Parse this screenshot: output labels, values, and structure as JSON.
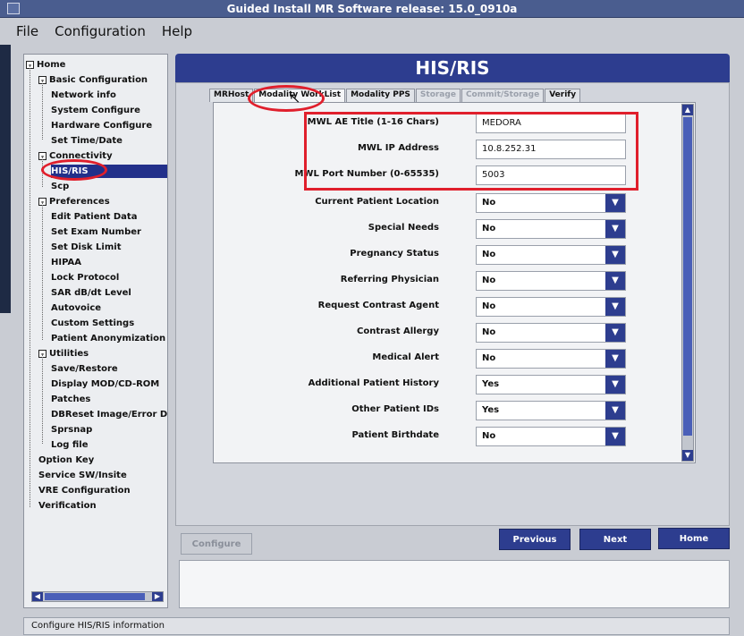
{
  "window": {
    "title": "Guided Install  MR Software release: 15.0_0910a"
  },
  "menu": [
    "File",
    "Configuration",
    "Help"
  ],
  "sidebar": {
    "items": [
      {
        "label": "Home",
        "box": "-"
      },
      {
        "label": "Basic Configuration",
        "box": "-"
      },
      {
        "label": "Network info"
      },
      {
        "label": "System Configure"
      },
      {
        "label": "Hardware Configure"
      },
      {
        "label": "Set Time/Date"
      },
      {
        "label": "Connectivity",
        "box": "-"
      },
      {
        "label": "HIS/RIS",
        "selected": true
      },
      {
        "label": "Scp"
      },
      {
        "label": "Preferences",
        "box": "-"
      },
      {
        "label": "Edit Patient Data"
      },
      {
        "label": "Set Exam Number"
      },
      {
        "label": "Set Disk Limit"
      },
      {
        "label": "HIPAA"
      },
      {
        "label": "Lock Protocol"
      },
      {
        "label": "SAR dB/dt Level"
      },
      {
        "label": "Autovoice"
      },
      {
        "label": "Custom Settings"
      },
      {
        "label": "Patient Anonymization S"
      },
      {
        "label": "Utilities",
        "box": "-"
      },
      {
        "label": "Save/Restore"
      },
      {
        "label": "Display MOD/CD-ROM"
      },
      {
        "label": "Patches"
      },
      {
        "label": "DBReset Image/Error DE"
      },
      {
        "label": "Sprsnap"
      },
      {
        "label": "Log file"
      },
      {
        "label": "Option Key"
      },
      {
        "label": "Service SW/Insite"
      },
      {
        "label": "VRE Configuration"
      },
      {
        "label": "Verification"
      }
    ]
  },
  "main": {
    "header": "HIS/RIS",
    "tabs": [
      {
        "label": "MRHost"
      },
      {
        "label": "Modality WorkList",
        "active": true
      },
      {
        "label": "Modality PPS"
      },
      {
        "label": "Storage",
        "disabled": true
      },
      {
        "label": "Commit/Storage",
        "disabled": true
      },
      {
        "label": "Verify"
      }
    ],
    "text_fields": [
      {
        "label": "MWL AE Title (1-16 Chars)",
        "value": "MEDORA"
      },
      {
        "label": "MWL IP Address",
        "value": "10.8.252.31"
      },
      {
        "label": "MWL Port Number (0-65535)",
        "value": "5003"
      }
    ],
    "select_fields": [
      {
        "label": "Current Patient Location",
        "value": "No"
      },
      {
        "label": "Special Needs",
        "value": "No"
      },
      {
        "label": "Pregnancy Status",
        "value": "No"
      },
      {
        "label": "Referring Physician",
        "value": "No"
      },
      {
        "label": "Request Contrast Agent",
        "value": "No"
      },
      {
        "label": "Contrast Allergy",
        "value": "No"
      },
      {
        "label": "Medical Alert",
        "value": "No"
      },
      {
        "label": "Additional Patient History",
        "value": "Yes"
      },
      {
        "label": "Other Patient IDs",
        "value": "Yes"
      },
      {
        "label": "Patient Birthdate",
        "value": "No"
      }
    ]
  },
  "buttons": {
    "configure": "Configure",
    "previous": "Previous",
    "next": "Next",
    "home": "Home"
  },
  "status": "Configure HIS/RIS information",
  "icons": {
    "dropdown": "chevron-down-icon",
    "tree_expander": "minus-box-icon",
    "cursor": "mouse-pointer-icon"
  },
  "colors": {
    "accent": "#2d3d8f",
    "annotation": "#e01f2c"
  }
}
